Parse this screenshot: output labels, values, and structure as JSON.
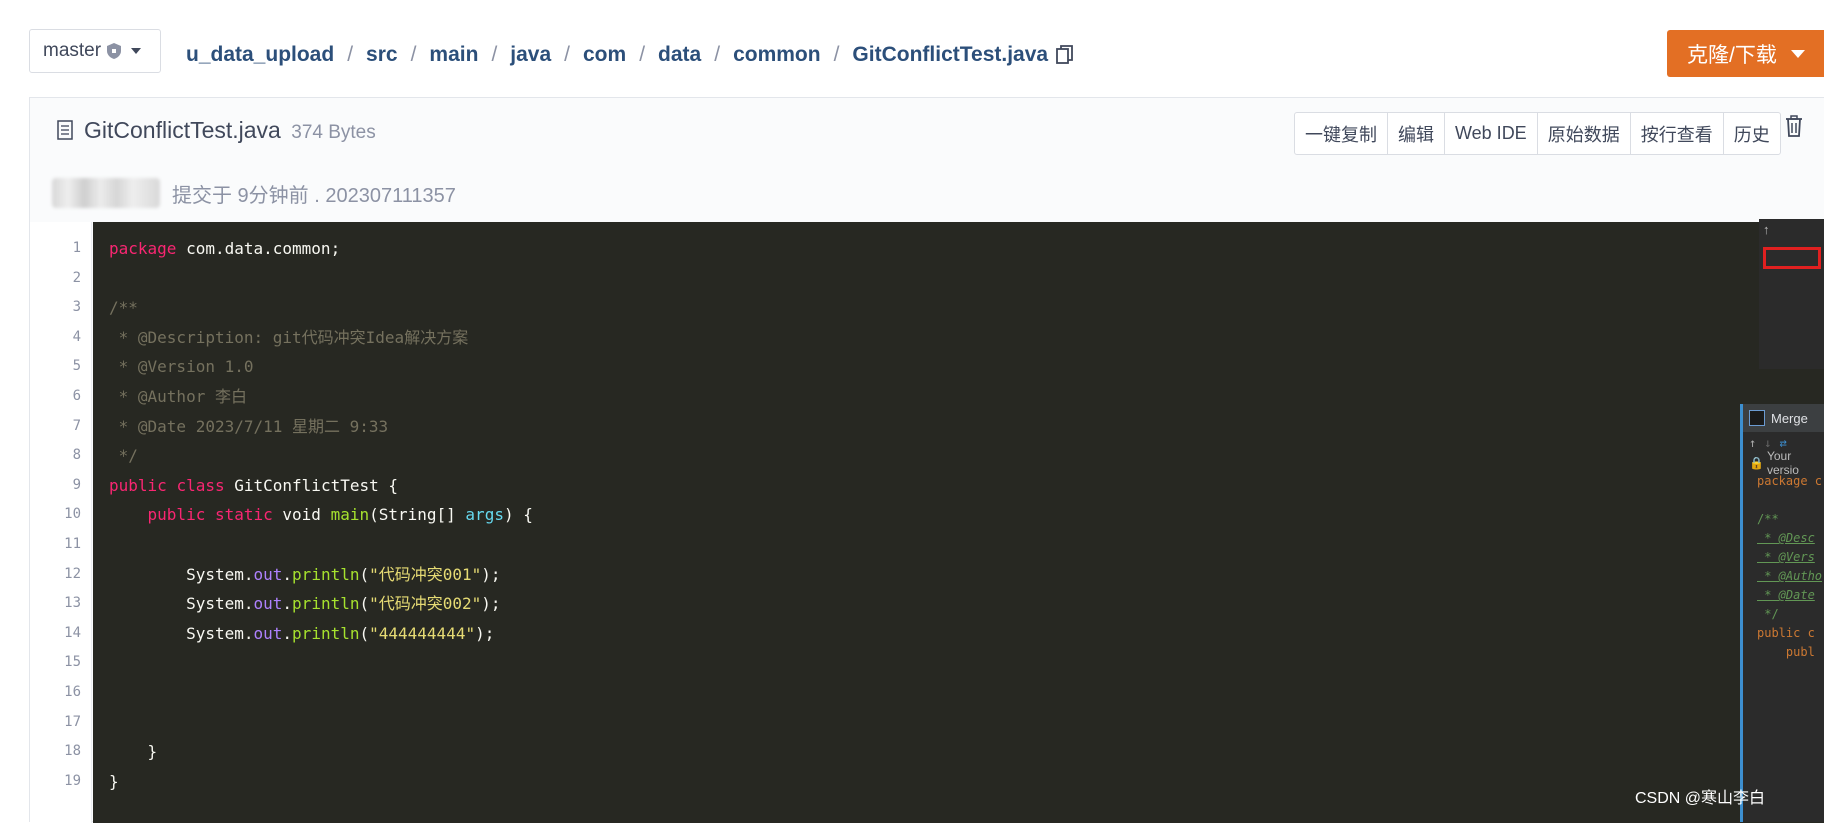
{
  "branch": {
    "name": "master"
  },
  "breadcrumb": {
    "segments": [
      "u_data_upload",
      "src",
      "main",
      "java",
      "com",
      "data",
      "common"
    ],
    "separator": "/",
    "file": "GitConflictTest.java"
  },
  "clone_button": {
    "label": "克隆/下载"
  },
  "file": {
    "name": "GitConflictTest.java",
    "size": "374 Bytes",
    "commit_text": "提交于 9分钟前 . 202307111357"
  },
  "actions": [
    "一键复制",
    "编辑",
    "Web IDE",
    "原始数据",
    "按行查看",
    "历史"
  ],
  "code": {
    "line_numbers": [
      "1",
      "2",
      "3",
      "4",
      "5",
      "6",
      "7",
      "8",
      "9",
      "10",
      "11",
      "12",
      "13",
      "14",
      "15",
      "16",
      "17",
      "18",
      "19"
    ]
  },
  "ide": {
    "merge_title": "Merge",
    "your_version": "Your versio",
    "lines": [
      "package c",
      "",
      "/**",
      " * @Desc",
      " * @Vers",
      " * @Autho",
      " * @Date",
      " */",
      "public c",
      "    publ"
    ]
  },
  "watermark": "CSDN @寒山李白",
  "colors": {
    "accent": "#e36f24",
    "link": "#2c4f7a",
    "code_bg": "#272822"
  }
}
